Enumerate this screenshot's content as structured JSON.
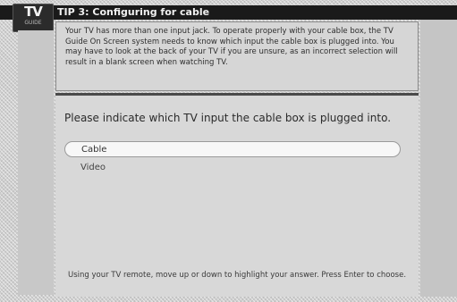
{
  "header": {
    "logo_text": "TV",
    "logo_subtext": "GUIDE",
    "title": "TIP 3: Configuring for cable"
  },
  "info": {
    "text": "Your TV has more than one input jack. To operate properly with your cable box, the TV Guide On Screen system needs to know which input the cable box is plugged into. You may have to look at the back of your TV if you are unsure, as an incorrect selection will result in a blank screen when watching TV."
  },
  "question": {
    "text": "Please indicate which TV input the cable box is plugged into."
  },
  "options": [
    {
      "label": "Cable",
      "selected": true
    },
    {
      "label": "Video",
      "selected": false
    }
  ],
  "footer": {
    "instructions": "Using your TV remote, move up or down to highlight your answer. Press Enter to choose."
  }
}
